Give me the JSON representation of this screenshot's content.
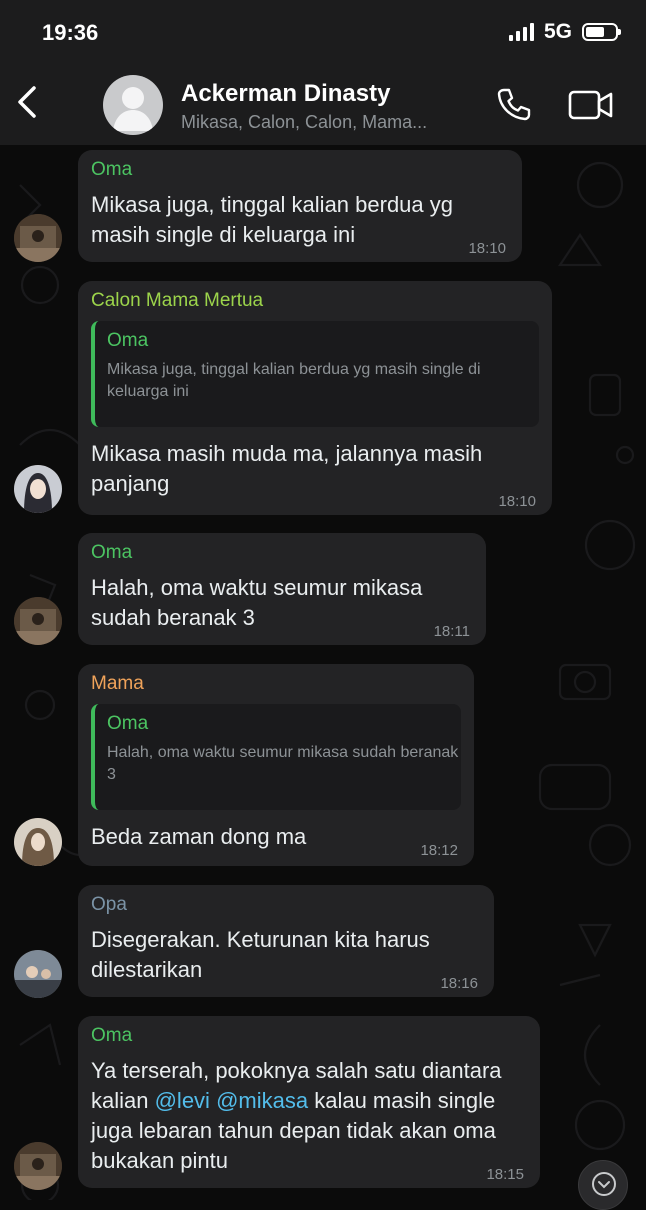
{
  "status": {
    "time": "19:36",
    "network": "5G"
  },
  "header": {
    "title": "Ackerman Dinasty",
    "subtitle": "Mikasa, Calon, Calon, Mama..."
  },
  "messages": [
    {
      "sender": "Oma",
      "sender_color": "#4cc462",
      "text": "Mikasa juga, tinggal kalian berdua yg masih single di keluarga ini",
      "time": "18:10"
    },
    {
      "sender": "Calon Mama Mertua",
      "sender_color": "#9cd44b",
      "quote": {
        "sender": "Oma",
        "text": "Mikasa juga, tinggal kalian berdua yg masih single di keluarga ini"
      },
      "text": "Mikasa masih muda ma, jalannya masih panjang",
      "time": "18:10"
    },
    {
      "sender": "Oma",
      "sender_color": "#4cc462",
      "text": "Halah, oma waktu seumur mikasa sudah beranak 3",
      "time": "18:11"
    },
    {
      "sender": "Mama",
      "sender_color": "#f0a35a",
      "quote": {
        "sender": "Oma",
        "text": "Halah, oma waktu seumur mikasa sudah beranak 3"
      },
      "text": "Beda zaman dong ma",
      "time": "18:12"
    },
    {
      "sender": "Opa",
      "sender_color": "#7b93a6",
      "text": "Disegerakan. Keturunan kita harus dilestarikan",
      "time": "18:16"
    },
    {
      "sender": "Oma",
      "sender_color": "#4cc462",
      "text_parts": [
        "Ya terserah, pokoknya salah satu diantara kalian ",
        "@levi",
        " ",
        "@mikasa",
        " kalau masih single juga lebaran tahun depan tidak akan oma bukakan pintu"
      ],
      "time": "18:15"
    }
  ],
  "icons": [
    "back-icon",
    "group-avatar-icon",
    "phone-icon",
    "video-call-icon",
    "scroll-down-icon"
  ],
  "colors": {
    "header_bg": "#1c1c1d",
    "bubble_bg": "#232325",
    "mention": "#53bdeb",
    "quote_bar": "#3fbb5b"
  }
}
